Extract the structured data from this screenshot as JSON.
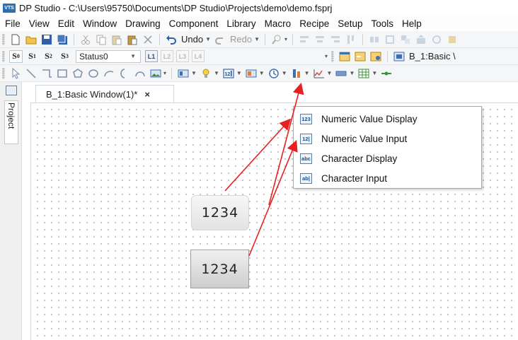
{
  "window": {
    "title": "DP Studio - C:\\Users\\95750\\Documents\\DP Studio\\Projects\\demo\\demo.fsprj",
    "logo": "VTS"
  },
  "menubar": [
    "File",
    "View",
    "Edit",
    "Window",
    "Drawing",
    "Component",
    "Library",
    "Macro",
    "Recipe",
    "Setup",
    "Tools",
    "Help"
  ],
  "toolbar1": {
    "undo_label": "Undo",
    "redo_label": "Redo"
  },
  "toolbar2": {
    "state_buttons": [
      "S",
      "S",
      "S",
      "S"
    ],
    "state_subscripts": [
      "0",
      "1",
      "2",
      "3"
    ],
    "state_select_value": "Status0",
    "layer_buttons": [
      "L1",
      "L2",
      "L3",
      "L4"
    ],
    "window_label": "B_1:Basic \\"
  },
  "side_panel": {
    "tab_label": "Project"
  },
  "document_tab": {
    "label": "B_1:Basic Window(1)*",
    "close": "×"
  },
  "component_menu": {
    "items": [
      {
        "label": "Numeric Value Display",
        "icon_text": "123",
        "icon": "numeric-display-icon"
      },
      {
        "label": "Numeric Value Input",
        "icon_text": "12|",
        "icon": "numeric-input-icon"
      },
      {
        "label": "Character Display",
        "icon_text": "abc",
        "icon": "character-display-icon"
      },
      {
        "label": "Character Input",
        "icon_text": "ab|",
        "icon": "character-input-icon"
      }
    ]
  },
  "canvas": {
    "numeric_display_value": "1234",
    "numeric_input_value": "1234"
  },
  "colors": {
    "arrow": "#e8201f",
    "highlight": "#ffe9a0",
    "accent": "#2c6fb8"
  }
}
